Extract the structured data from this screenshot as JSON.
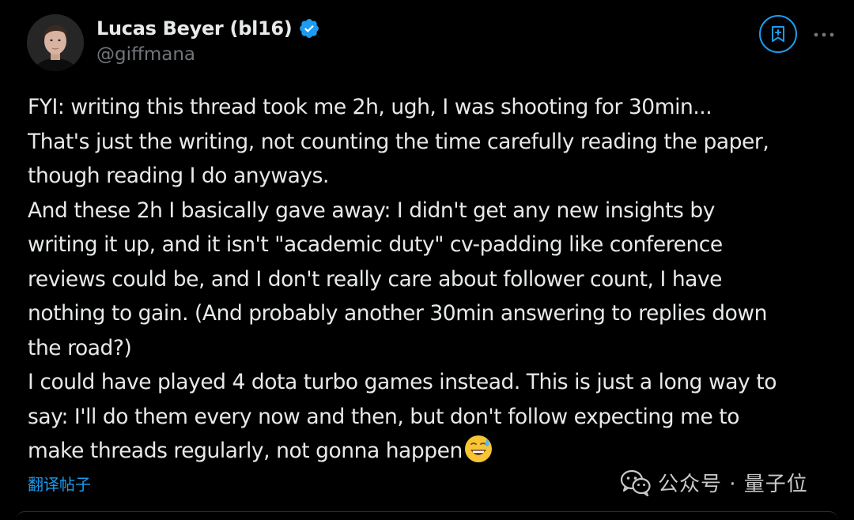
{
  "author": {
    "display_name": "Lucas Beyer (bl16)",
    "handle": "@giffmana",
    "verified": true,
    "avatar_icon": "profile-photo"
  },
  "actions": {
    "bookmark_icon": "bookmark-plus-icon",
    "more_icon": "more-horizontal-icon"
  },
  "tweet": {
    "lines": [
      "FYI: writing this thread took me 2h, ugh, I was shooting for 30min...",
      "That's just the writing, not counting the time carefully reading the paper,",
      "though reading I do anyways.",
      "And these 2h I basically gave away: I didn't get any new insights by",
      "writing it up, and it isn't \"academic duty\" cv-padding like conference",
      "reviews could be, and I don't really care about follower count, I have",
      "nothing to gain. (And probably another 30min answering to replies down",
      "the road?)",
      "I could have played 4 dota turbo games instead. This is just a long way to",
      "say: I'll do them every now and then, but don't follow expecting me to",
      "make threads regularly, not gonna happen"
    ],
    "trailing_emoji": "😅"
  },
  "translate_label": "翻译帖子",
  "watermark": {
    "text": "公众号 · 量子位"
  },
  "colors": {
    "background": "#000000",
    "text": "#e7e9ea",
    "secondary_text": "#71767b",
    "accent": "#1d9bf0"
  }
}
